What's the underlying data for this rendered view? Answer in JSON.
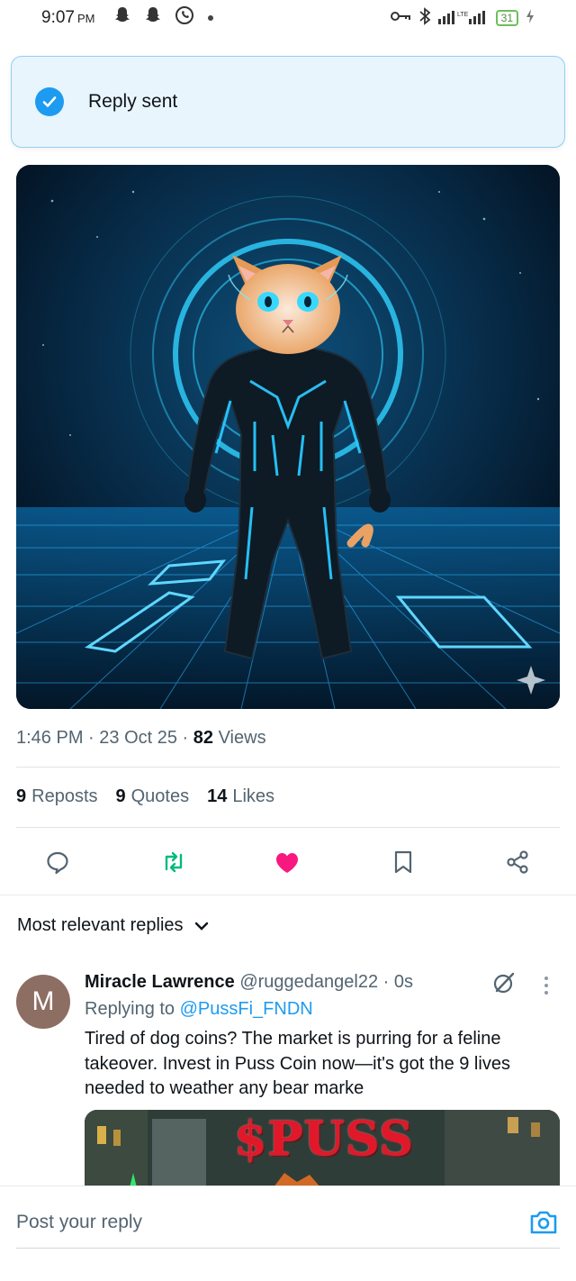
{
  "status_bar": {
    "time": "9:07",
    "ampm": "PM",
    "battery": "31"
  },
  "toast": {
    "message": "Reply sent"
  },
  "post": {
    "time": "1:46 PM",
    "date": "23 Oct 25",
    "views_count": "82",
    "views_label": "Views",
    "reposts_count": "9",
    "reposts_label": "Reposts",
    "quotes_count": "9",
    "quotes_label": "Quotes",
    "likes_count": "14",
    "likes_label": "Likes",
    "liked": true,
    "accent_color": "#1d9bf0",
    "like_color": "#f91880",
    "repost_color": "#00ba7c"
  },
  "replies_filter": {
    "label": "Most relevant replies"
  },
  "reply": {
    "avatar_letter": "M",
    "name": "Miracle Lawrence",
    "handle": "@ruggedangel22",
    "age": "0s",
    "replying_to_label": "Replying to",
    "replying_to_handle": "@PussFi_FNDN",
    "text": "Tired of dog coins? The market is purring for a feline takeover. Invest in Puss Coin now—it's got the 9 lives needed to weather any bear marke",
    "media_text": "$PUSS"
  },
  "composer": {
    "placeholder": "Post your reply"
  }
}
